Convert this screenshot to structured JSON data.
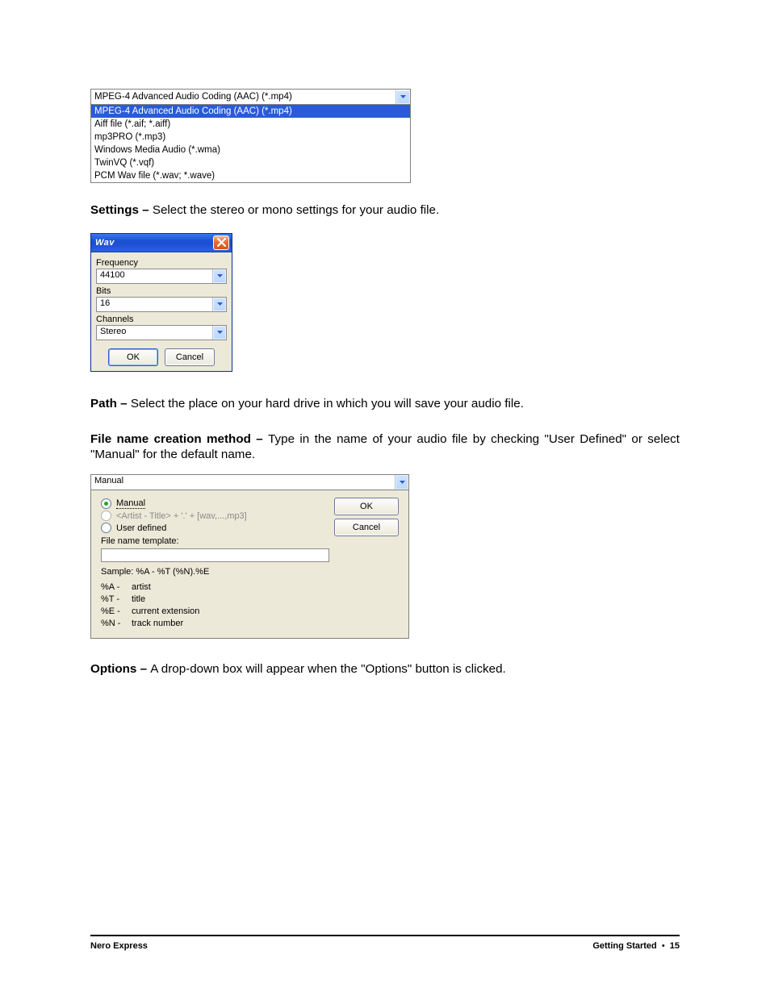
{
  "format_combo": {
    "selected": "MPEG-4 Advanced Audio Coding (AAC) (*.mp4)",
    "options": [
      "MPEG-4 Advanced Audio Coding (AAC) (*.mp4)",
      "Aiff file (*.aif; *.aiff)",
      "mp3PRO (*.mp3)",
      "Windows Media Audio (*.wma)",
      "TwinVQ (*.vqf)",
      "PCM Wav file (*.wav; *.wave)"
    ]
  },
  "para_settings": {
    "label": "Settings – ",
    "text": "Select the stereo or mono settings for your audio file."
  },
  "wav_dialog": {
    "title": "Wav",
    "frequency_label": "Frequency",
    "frequency_value": "44100",
    "bits_label": "Bits",
    "bits_value": "16",
    "channels_label": "Channels",
    "channels_value": "Stereo",
    "ok": "OK",
    "cancel": "Cancel"
  },
  "para_path": {
    "label": "Path – ",
    "text": "Select the place on your hard drive in which you will save your audio file."
  },
  "para_file": {
    "label": "File name creation method – ",
    "text": "Type in the name of your audio file by checking \"User Defined\" or select \"Manual\" for the default name."
  },
  "manual_panel": {
    "selected": "Manual",
    "radio_manual": "Manual",
    "radio_pattern": "<Artist - Title> + '.' + [wav,...,mp3]",
    "radio_user": "User defined",
    "template_label": "File name template:",
    "template_value": "",
    "sample": "Sample: %A - %T (%N).%E",
    "legend": [
      {
        "key": "%A -",
        "val": "artist"
      },
      {
        "key": "%T -",
        "val": "title"
      },
      {
        "key": "%E -",
        "val": "current extension"
      },
      {
        "key": "%N -",
        "val": "track number"
      }
    ],
    "ok": "OK",
    "cancel": "Cancel"
  },
  "para_options": {
    "label": "Options – ",
    "text": "A drop-down box will appear when the \"Options\" button is clicked."
  },
  "footer": {
    "left": "Nero Express",
    "section": "Getting Started",
    "dot": "•",
    "page": "15"
  }
}
